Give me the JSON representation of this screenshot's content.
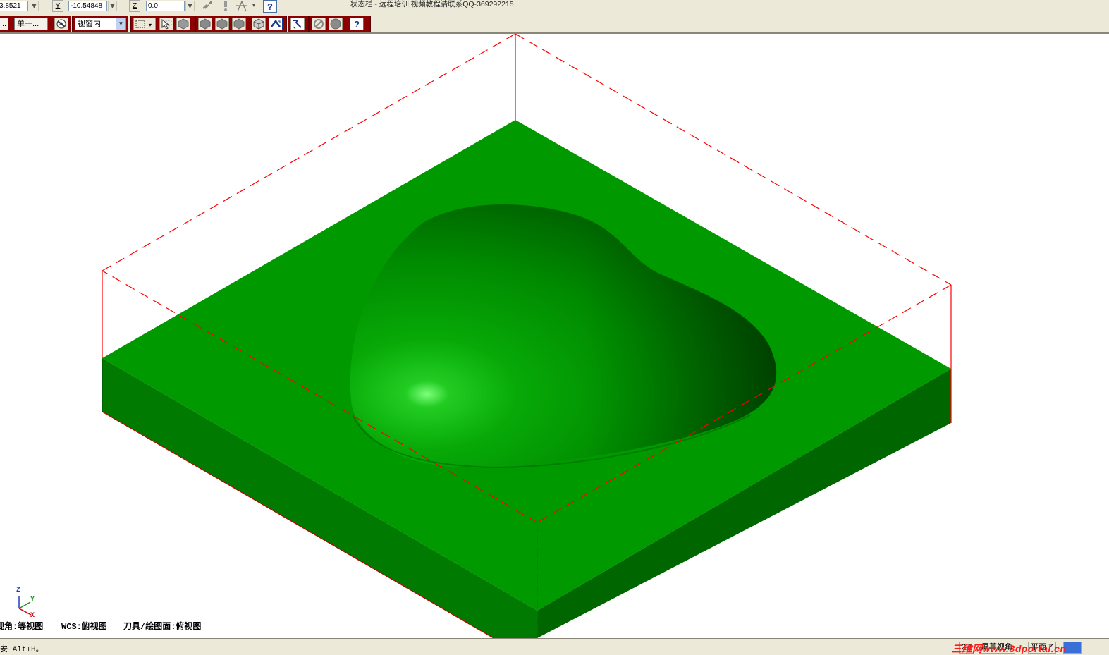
{
  "coord_bar": {
    "x_value": "3.8521",
    "y_label": "Y",
    "y_value": "-10.54848",
    "z_label": "Z",
    "z_value": "0.0",
    "status_title": "状态栏 - 远程培训,视频教程请联系QQ-369292215"
  },
  "toolbar2": {
    "single_button": "单一...",
    "view_select": "视窗内",
    "dropdown_arrow": "▼"
  },
  "viewport": {
    "gview_label": "视角:等视图",
    "wcs_label": "WCS:俯视图",
    "tplane_label": "刀具/绘图面:俯视图",
    "axis_z": "Z",
    "axis_y": "Y",
    "axis_x": "X",
    "colors": {
      "stock_top": "#009900",
      "stock_front_left": "#007a00",
      "stock_front_right": "#006600",
      "boundary": "#ff0000"
    }
  },
  "status_bar": {
    "prompt": "安 Alt+H。",
    "cell_2d": "2D",
    "cell_cplane": "屏幕视角",
    "cell_tplane": "平面 Z",
    "watermark": "三维网www.3dportal.cn"
  }
}
